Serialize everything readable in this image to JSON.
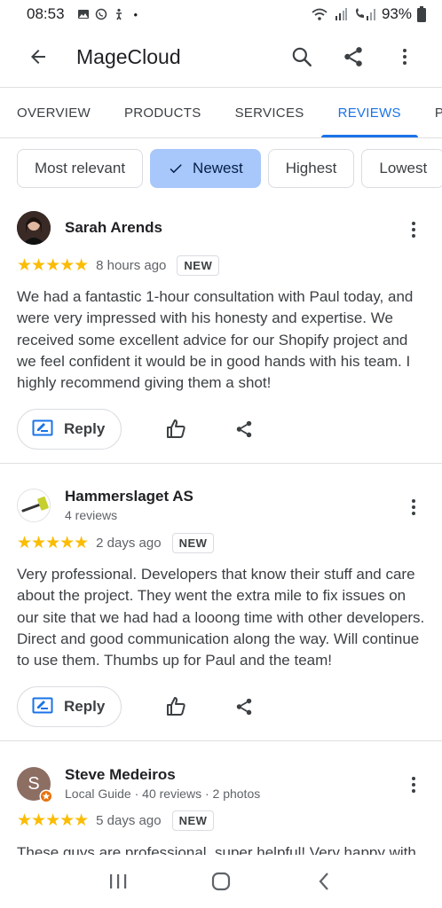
{
  "status_bar": {
    "time": "08:53",
    "battery": "93%",
    "dot": "•"
  },
  "app_bar": {
    "title": "MageCloud"
  },
  "tabs": [
    {
      "label": "OVERVIEW"
    },
    {
      "label": "PRODUCTS"
    },
    {
      "label": "SERVICES"
    },
    {
      "label": "REVIEWS"
    },
    {
      "label": "PHOTOS"
    }
  ],
  "chips": [
    {
      "label": "Most relevant"
    },
    {
      "label": "Newest"
    },
    {
      "label": "Highest"
    },
    {
      "label": "Lowest"
    }
  ],
  "reviews": [
    {
      "name": "Sarah Arends",
      "sub": "",
      "stars": "★★★★★",
      "time": "8 hours ago",
      "badge": "NEW",
      "text": "We had a fantastic 1-hour consultation with Paul today, and were very impressed with his honesty and expertise. We received some excellent advice for our Shopify project and we feel confident it would be in good hands with his team. I highly recommend giving them a shot!",
      "reply_label": "Reply"
    },
    {
      "name": "Hammerslaget AS",
      "sub": "4 reviews",
      "stars": "★★★★★",
      "time": "2 days ago",
      "badge": "NEW",
      "text": "Very professional. Developers that know their stuff and care about the project. They went the extra mile to fix issues on our site that we had had a looong time with other developers. Direct and good communication along the way. Will continue to use them. Thumbs up for Paul and the team!",
      "reply_label": "Reply"
    },
    {
      "name": "Steve Medeiros",
      "sub": "Local Guide · 40 reviews · 2 photos",
      "avatar_letter": "S",
      "stars": "★★★★★",
      "time": "5 days ago",
      "badge": "NEW",
      "text": "These guys are professional, super helpful! Very happy with"
    }
  ],
  "colors": {
    "accent": "#1a73e8",
    "star": "#fbbc04",
    "chip_selected": "#a8c7fa",
    "avatar_steve": "#8d6e63"
  }
}
